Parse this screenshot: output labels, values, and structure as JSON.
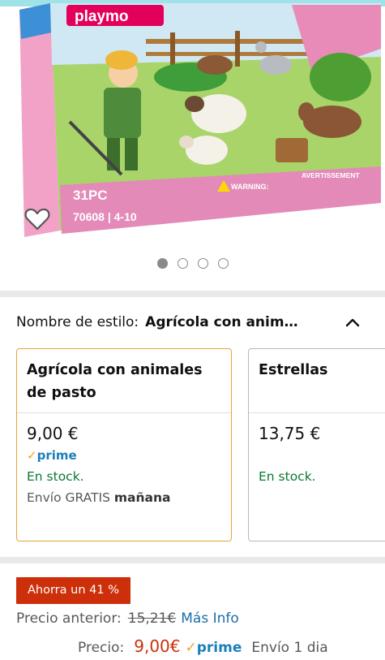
{
  "product_image": {
    "brand_text": "playmo",
    "pieces_text": "31PC",
    "model_text": "70608 | 4-10",
    "warning_text": "WARNING:",
    "avertissement_text": "AVERTISSEMENT",
    "alt_description_icon": "product-image"
  },
  "carousel": {
    "dot_count": 4,
    "active_index": 0
  },
  "style": {
    "label": "Nombre de estilo:",
    "value": "Agrícola con anim…"
  },
  "variations": [
    {
      "title": "Agrícola con animales de pasto",
      "price": "9,00 €",
      "prime": "prime",
      "stock": "En stock.",
      "shipping_prefix": "Envío GRATIS",
      "shipping_day": "mañana",
      "selected": true
    },
    {
      "title": "Estrellas",
      "price": "13,75 €",
      "stock": "En stock.",
      "selected": false
    }
  ],
  "deal": {
    "badge": "Ahorra un 41 %",
    "previous_label": "Precio anterior:",
    "previous_price": "15,21€",
    "more_info": "Más Info",
    "price_label": "Precio:",
    "price": "9,00€",
    "prime": "prime",
    "shipping": "Envío 1 dia"
  },
  "colors": {
    "deal_red": "#cc2f0a",
    "stock_green": "#0a7a2f",
    "prime_blue": "#1b7fb8",
    "selected_border": "#e8a33c"
  }
}
